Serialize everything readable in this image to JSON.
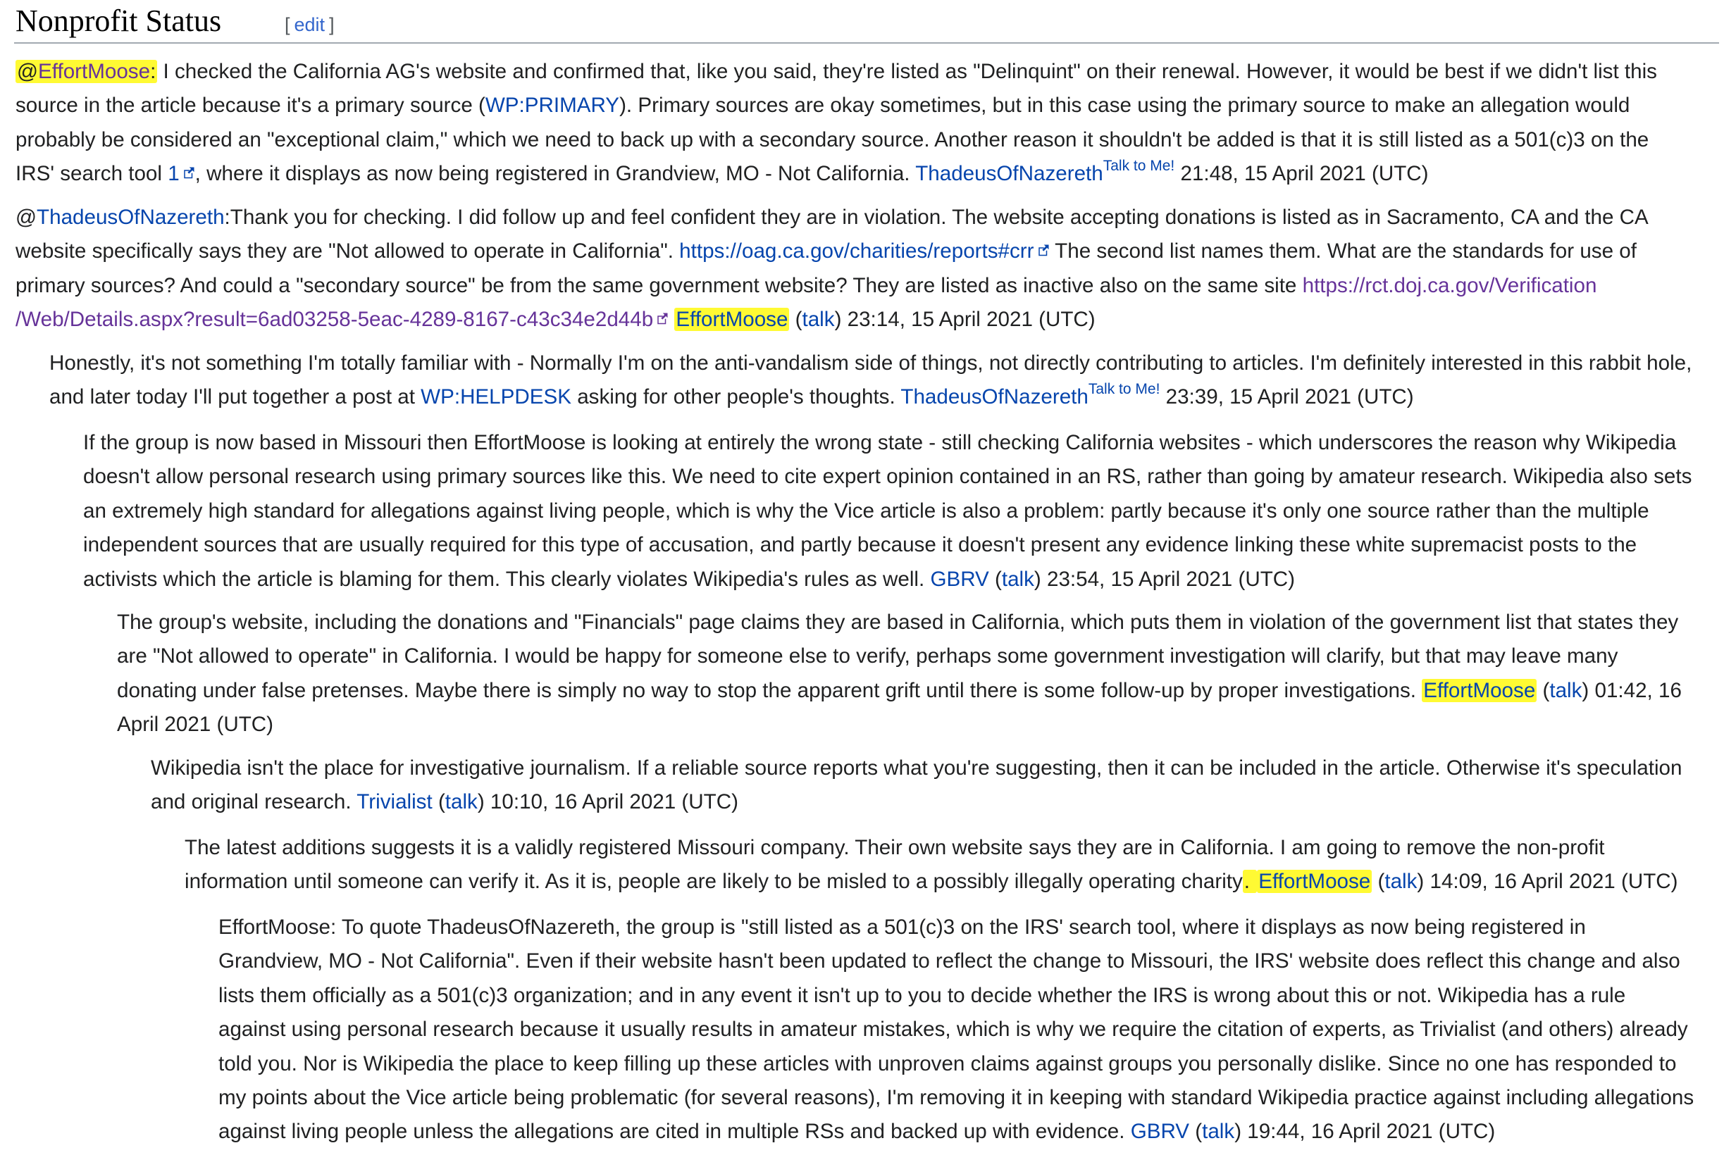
{
  "section": {
    "title": "Nonprofit Status",
    "edit_label": "edit",
    "bracket_open": "[",
    "bracket_close": "]"
  },
  "comments": [
    {
      "ping_at": "@",
      "ping": "EffortMoose",
      "colon": ":",
      "t1": " I checked the California AG's website and confirmed that, like you said, they're listed as \"Delinquint\" on their renewal. However, it would be best if we didn't list this\nsource in the article because it's a primary source (",
      "wp_link": "WP:PRIMARY",
      "t2": "). Primary sources are okay sometimes, but in this case using the primary source to make an allegation would\nprobably be considered an \"exceptional claim,\" which we need to back up with a secondary source. Another reason it shouldn't be added is that it is still listed as a 501(c)3 on the\nIRS' search tool ",
      "ext_link": "1",
      "t3": ", where it displays as now being registered in Grandview, MO - Not California. ",
      "sig_user": "ThadeusOfNazereth",
      "sig_talk": "Talk to Me!",
      "timestamp": " 21:48, 15 April 2021 (UTC)"
    },
    {
      "ping_at": "@",
      "ping": "ThadeusOfNazereth",
      "t1": ":Thank you for checking. I did follow up and feel confident they are in violation. The website accepting donations is listed as in Sacramento, CA and the CA\nwebsite specifically says they are \"Not allowed to operate in California\". ",
      "url1": "https://oag.ca.gov/charities/reports#crr",
      "t2": " The second list names them. What are the standards for use of\nprimary sources? And could a \"secondary source\" be from the same government website? They are listed as inactive also on the same site ",
      "url2": "https://rct.doj.ca.gov/Verification\n/Web/Details.aspx?result=6ad03258-5eac-4289-8167-c43c34e2d44b",
      "sp": " ",
      "sig_user": "EffortMoose",
      "paren_open": " (",
      "sig_talk": "talk",
      "timestamp": ") 23:14, 15 April 2021 (UTC)"
    },
    {
      "t1": "Honestly, it's not something I'm totally familiar with - Normally I'm on the anti-vandalism side of things, not directly contributing to articles. I'm definitely interested in this rabbit hole,\nand later today I'll put together a post at ",
      "wp_link": "WP:HELPDESK",
      "t2": " asking for other people's thoughts. ",
      "sig_user": "ThadeusOfNazereth",
      "sig_talk": "Talk to Me!",
      "timestamp": " 23:39, 15 April 2021 (UTC)"
    },
    {
      "t1": "If the group is now based in Missouri then EffortMoose is looking at entirely the wrong state - still checking California websites - which underscores the reason why Wikipedia\ndoesn't allow personal research using primary sources like this. We need to cite expert opinion contained in an RS, rather than going by amateur research. Wikipedia also sets\nan extremely high standard for allegations against living people, which is why the Vice article is also a problem: partly because it's only one source rather than the multiple\nindependent sources that are usually required for this type of accusation, and partly because it doesn't present any evidence linking these white supremacist posts to the\nactivists which the article is blaming for them. This clearly violates Wikipedia's rules as well. ",
      "sig_user": "GBRV",
      "paren_open": " (",
      "sig_talk": "talk",
      "timestamp": ") 23:54, 15 April 2021 (UTC)"
    },
    {
      "t1": "The group's website, including the donations and \"Financials\" page claims they are based in California, which puts them in violation of the government list that states they\nare \"Not allowed to operate\" in California. I would be happy for someone else to verify, perhaps some government investigation will clarify, but that may leave many\ndonating under false pretenses. Maybe there is simply no way to stop the apparent grift until there is some follow-up by proper investigations. ",
      "sig_user": "EffortMoose",
      "paren_open": " (",
      "sig_talk": "talk",
      "timestamp": ") 01:42, 16\nApril 2021 (UTC)"
    },
    {
      "t1": "Wikipedia isn't the place for investigative journalism. If a reliable source reports what you're suggesting, then it can be included in the article. Otherwise it's speculation\nand original research. ",
      "sig_user": "Trivialist",
      "paren_open": " (",
      "sig_talk": "talk",
      "timestamp": ") 10:10, 16 April 2021 (UTC)"
    },
    {
      "t1": "The latest additions suggests it is a validly registered Missouri company. Their own website says they are in California. I am going to remove the non-profit\ninformation until someone can verify it. As it is, people are likely to be misled to a possibly illegally operating charity",
      "t1_hl": ". ",
      "sig_user": "EffortMoose",
      "paren_open": " (",
      "sig_talk": "talk",
      "timestamp": ") 14:09, 16 April 2021 (UTC)"
    },
    {
      "t1": "EffortMoose: To quote ThadeusOfNazereth, the group is \"still listed as a 501(c)3 on the IRS' search tool, where it displays as now being registered in\nGrandview, MO - Not California\". Even if their website hasn't been updated to reflect the change to Missouri, the IRS' website does reflect this change and also\nlists them officially as a 501(c)3 organization; and in any event it isn't up to you to decide whether the IRS is wrong about this or not. Wikipedia has a rule\nagainst using personal research because it usually results in amateur mistakes, which is why we require the citation of experts, as Trivialist (and others) already\ntold you. Nor is Wikipedia the place to keep filling up these articles with unproven claims against groups you personally dislike. Since no one has responded to\nmy points about the Vice article being problematic (for several reasons), I'm removing it in keeping with standard Wikipedia practice against including allegations\nagainst living people unless the allegations are cited in multiple RSs and backed up with evidence. ",
      "sig_user": "GBRV",
      "paren_open": " (",
      "sig_talk": "talk",
      "timestamp": ") 19:44, 16 April 2021 (UTC)"
    }
  ],
  "colors": {
    "link": "#0645ad",
    "visited": "#663399",
    "highlight": "#fffa33",
    "text": "#202122"
  },
  "icons": {
    "external_link": "external-link-icon"
  }
}
